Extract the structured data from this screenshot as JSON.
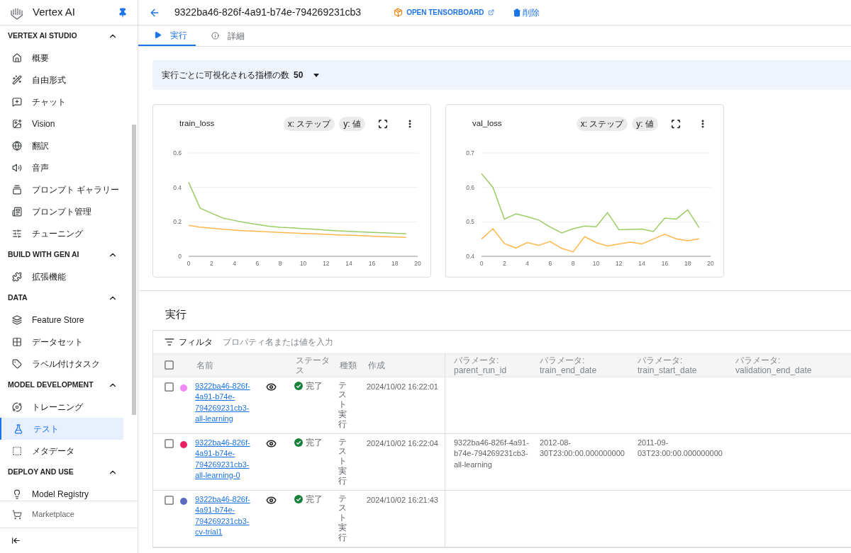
{
  "sidebar": {
    "title": "Vertex AI",
    "sections": [
      {
        "label": "VERTEX AI STUDIO",
        "expanded": true,
        "items": [
          {
            "label": "概要",
            "selected": false
          },
          {
            "label": "自由形式",
            "selected": false
          },
          {
            "label": "チャット",
            "selected": false
          },
          {
            "label": "Vision",
            "selected": false
          },
          {
            "label": "翻訳",
            "selected": false
          },
          {
            "label": "音声",
            "selected": false
          },
          {
            "label": "プロンプト ギャラリー",
            "selected": false
          },
          {
            "label": "プロンプト管理",
            "selected": false
          },
          {
            "label": "チューニング",
            "selected": false
          }
        ]
      },
      {
        "label": "BUILD WITH GEN AI",
        "expanded": true,
        "items": [
          {
            "label": "拡張機能",
            "selected": false
          }
        ]
      },
      {
        "label": "DATA",
        "expanded": true,
        "items": [
          {
            "label": "Feature Store",
            "selected": false
          },
          {
            "label": "データセット",
            "selected": false
          },
          {
            "label": "ラベル付けタスク",
            "selected": false
          }
        ]
      },
      {
        "label": "MODEL DEVELOPMENT",
        "expanded": true,
        "items": [
          {
            "label": "トレーニング",
            "selected": false
          },
          {
            "label": "テスト",
            "selected": true
          },
          {
            "label": "メタデータ",
            "selected": false
          }
        ]
      },
      {
        "label": "DEPLOY AND USE",
        "expanded": true,
        "items": [
          {
            "label": "Model Registry",
            "selected": false
          }
        ]
      }
    ],
    "footer_item": "Marketplace"
  },
  "header": {
    "title": "9322ba46-826f-4a91-b74e-794269231cb3",
    "tensorboard_label": "OPEN TENSORBOARD",
    "delete_label": "削除"
  },
  "tabs": [
    {
      "label": "実行",
      "selected": true
    },
    {
      "label": "詳細",
      "selected": false
    }
  ],
  "metrics_bar": {
    "label": "実行ごとに可視化される指標の数",
    "value": "50"
  },
  "charts": [
    {
      "title": "train_loss",
      "x_chip": "x: ステップ",
      "y_chip": "y: 値",
      "chart_data": {
        "type": "line",
        "xlim": [
          0,
          20
        ],
        "ylim": [
          0,
          0.6
        ],
        "xticks": [
          0,
          2,
          4,
          6,
          8,
          10,
          12,
          14,
          16,
          18,
          20
        ],
        "yticks": [
          {
            "value": 0,
            "label": "0"
          },
          {
            "value": 0.2,
            "label": "0.2"
          },
          {
            "value": 0.4,
            "label": "0.4"
          },
          {
            "value": 0.6,
            "label": "0.6"
          }
        ],
        "x": [
          0,
          1,
          2,
          3,
          4,
          5,
          6,
          7,
          8,
          9,
          10,
          11,
          12,
          13,
          14,
          15,
          16,
          17,
          18,
          19
        ],
        "series": [
          {
            "color": "#9ccc65",
            "values": [
              0.43,
              0.28,
              0.25,
              0.222,
              0.208,
              0.195,
              0.185,
              0.175,
              0.168,
              0.165,
              0.16,
              0.157,
              0.152,
              0.148,
              0.145,
              0.142,
              0.139,
              0.137,
              0.134,
              0.131
            ]
          },
          {
            "color": "#ffb74d",
            "values": [
              0.18,
              0.17,
              0.163,
              0.157,
              0.152,
              0.148,
              0.145,
              0.142,
              0.139,
              0.136,
              0.133,
              0.13,
              0.127,
              0.124,
              0.122,
              0.12,
              0.117,
              0.114,
              0.112,
              0.11
            ]
          }
        ]
      }
    },
    {
      "title": "val_loss",
      "x_chip": "x: ステップ",
      "y_chip": "y: 値",
      "chart_data": {
        "type": "line",
        "xlim": [
          0,
          20
        ],
        "ylim": [
          0.4,
          0.7
        ],
        "xticks": [
          0,
          2,
          4,
          6,
          8,
          10,
          12,
          14,
          16,
          18,
          20
        ],
        "yticks": [
          0.4,
          0.5,
          0.6,
          0.7
        ],
        "x": [
          0,
          1,
          2,
          3,
          4,
          5,
          6,
          7,
          8,
          9,
          10,
          11,
          12,
          13,
          14,
          15,
          16,
          17,
          18,
          19
        ],
        "series": [
          {
            "color": "#9ccc65",
            "values": [
              0.64,
              0.6,
              0.508,
              0.523,
              0.515,
              0.505,
              0.485,
              0.468,
              0.48,
              0.488,
              0.486,
              0.527,
              0.477,
              0.478,
              0.479,
              0.472,
              0.511,
              0.508,
              0.535,
              0.483
            ]
          },
          {
            "color": "#ffb74d",
            "values": [
              0.45,
              0.48,
              0.437,
              0.424,
              0.44,
              0.432,
              0.443,
              0.423,
              0.413,
              0.457,
              0.44,
              0.43,
              0.436,
              0.441,
              0.436,
              0.45,
              0.464,
              0.451,
              0.445,
              0.451
            ]
          }
        ]
      }
    }
  ],
  "runs": {
    "title": "実行",
    "filter_label": "フィルタ",
    "filter_placeholder": "プロパティ名または値を入力",
    "header_checked": false,
    "columns": [
      "名前",
      "ステータス",
      "種類",
      "作成",
      "パラメータ: parent_run_id",
      "パラメータ: train_end_date",
      "パラメータ: train_start_date",
      "パラメータ: validation_end_date"
    ],
    "rows": [
      {
        "checked": false,
        "color": "#ee88f5",
        "name": "9322ba46-826f-4a91-b74e-794269231cb3-all-learning",
        "status": "完了",
        "type": "テスト実行",
        "created": "2024/10/02 16:22:01"
      },
      {
        "checked": false,
        "color": "#e91e63",
        "name": "9322ba46-826f-4a91-b74e-794269231cb3-all-learning-0",
        "status": "完了",
        "type": "テスト実行",
        "created": "2024/10/02 16:22:04",
        "parent_run_id": "9322ba46-826f-4a91-b74e-794269231cb3-all-learning",
        "train_end_date": "2012-08-30T23:00:00.000000000",
        "train_start_date": "2011-09-03T23:00:00.000000000"
      },
      {
        "checked": false,
        "color": "#5c6bc0",
        "name": "9322ba46-826f-4a91-b74e-794269231cb3-cv-trial1",
        "status": "完了",
        "type": "テスト実行",
        "created": "2024/10/02 16:21:43"
      }
    ]
  }
}
